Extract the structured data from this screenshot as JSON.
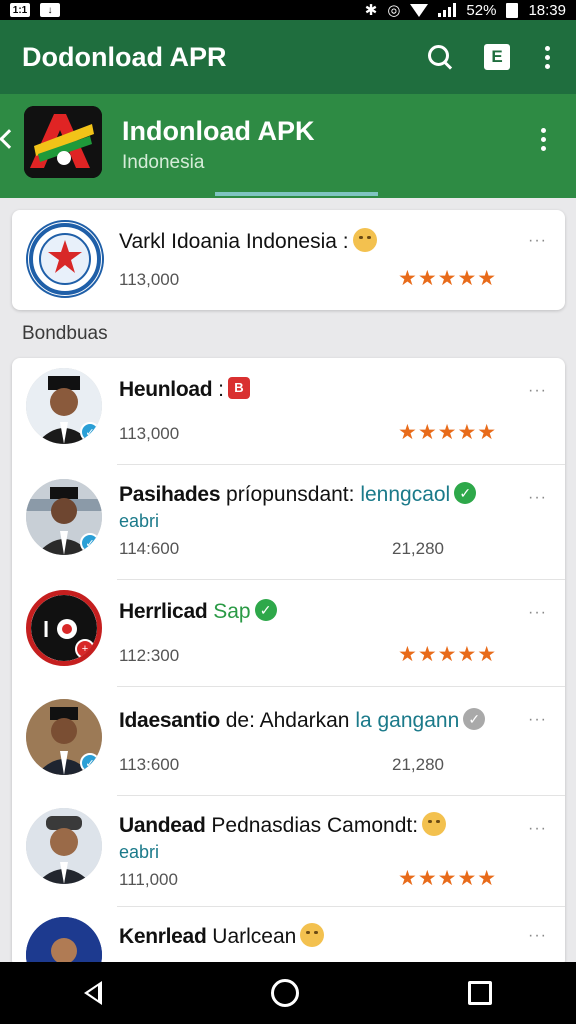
{
  "statusbar": {
    "left_badge": "1:1",
    "battery_pct": "52%",
    "time": "18:39"
  },
  "appbar": {
    "title": "Dodonload APR",
    "search_icon": "search-icon",
    "e_label": "E",
    "more_icon": "more-vert-icon"
  },
  "app_header": {
    "name": "Indonload APK",
    "subtitle": "Indonesia"
  },
  "featured": {
    "title": "Varkl Idoania Indonesia :",
    "count": "113,000",
    "rating": "★★★★★"
  },
  "section_label": "Bondbuas",
  "items": [
    {
      "title_bold": "Heunload",
      "title_rest": " :",
      "count": "113,000",
      "rating": "★★★★★",
      "tag": "B"
    },
    {
      "title_bold": "Pasihades",
      "title_rest": " príopunsdant: ",
      "title_accent": "lenngcaol",
      "sub": "eabri",
      "count": "114:600",
      "count2": "21,280"
    },
    {
      "title_bold": "Herrlicad",
      "title_accent": " Sap",
      "count": "112:300",
      "rating": "★★★★★"
    },
    {
      "title_bold": "Idaesantio",
      "title_rest": " de: Ahdarkan ",
      "title_accent": "la gangann",
      "count": "113:600",
      "count2": "21,280"
    },
    {
      "title_bold": "Uandead",
      "title_rest": " Pednasdias Camondt:",
      "sub": "eabri",
      "count": "111,000",
      "rating": "★★★★★"
    },
    {
      "title_bold": "Kenrlead",
      "title_rest": " Uarlcean"
    }
  ],
  "more_glyph": "···",
  "check_glyph": "✓"
}
